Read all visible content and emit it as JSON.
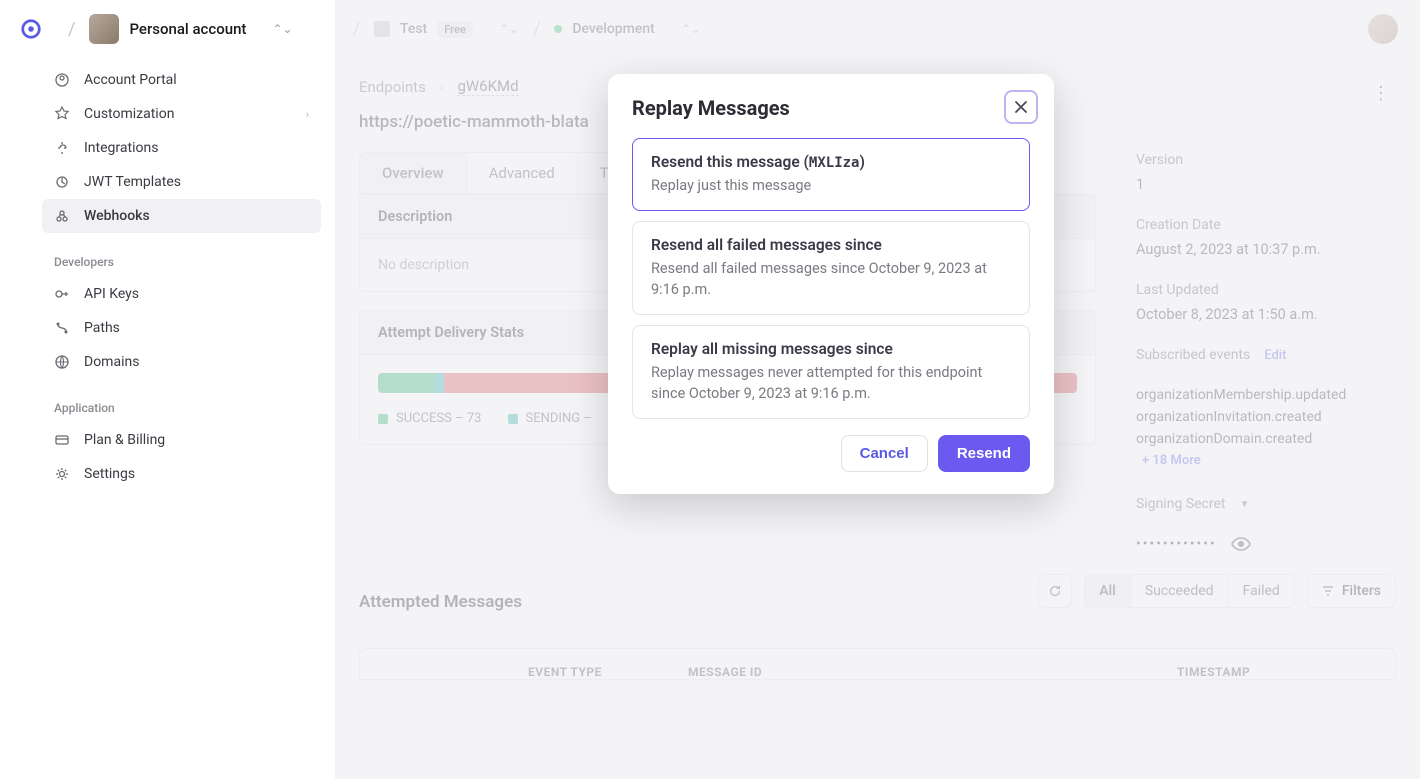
{
  "topbar": {
    "account_name": "Personal account",
    "env1_name": "Test",
    "env1_badge": "Free",
    "env2_name": "Development"
  },
  "sidebar": {
    "items": [
      {
        "label": "Account Portal"
      },
      {
        "label": "Customization"
      },
      {
        "label": "Integrations"
      },
      {
        "label": "JWT Templates"
      },
      {
        "label": "Webhooks"
      }
    ],
    "section_dev": "Developers",
    "dev_items": [
      {
        "label": "API Keys"
      },
      {
        "label": "Paths"
      },
      {
        "label": "Domains"
      }
    ],
    "section_app": "Application",
    "app_items": [
      {
        "label": "Plan & Billing"
      },
      {
        "label": "Settings"
      }
    ]
  },
  "breadcrumb": {
    "root": "Endpoints",
    "current": "gW6KMd"
  },
  "endpoint_url_prefix": "https://poetic-mammoth-blata",
  "tabs": {
    "overview": "Overview",
    "advanced": "Advanced",
    "third": "T"
  },
  "description_card": {
    "title": "Description",
    "body": "No description"
  },
  "stats_card": {
    "title": "Attempt Delivery Stats",
    "legend": [
      {
        "label": "SUCCESS – 73",
        "color": "#1fab67"
      },
      {
        "label": "SENDING –",
        "color": "#1fa9a0"
      }
    ]
  },
  "meta": {
    "version_label": "Version",
    "version_value": "1",
    "creation_label": "Creation Date",
    "creation_value": "August 2, 2023 at 10:37 p.m.",
    "updated_label": "Last Updated",
    "updated_value": "October 8, 2023 at 1:50 a.m.",
    "events_label": "Subscribed events",
    "edit": "Edit",
    "events": [
      "organizationMembership.updated",
      "organizationInvitation.created",
      "organizationDomain.created"
    ],
    "more": "+ 18 More",
    "secret_label": "Signing Secret",
    "secret_mask": "••••••••••••"
  },
  "messages": {
    "title": "Attempted Messages",
    "seg_all": "All",
    "seg_succeeded": "Succeeded",
    "seg_failed": "Failed",
    "filters": "Filters",
    "th_event": "EVENT TYPE",
    "th_msg": "MESSAGE ID",
    "th_ts": "TIMESTAMP"
  },
  "modal": {
    "title": "Replay Messages",
    "opt1_title_pre": "Resend this message (",
    "opt1_code": "MXLIza",
    "opt1_title_post": ")",
    "opt1_desc": "Replay just this message",
    "opt2_title": "Resend all failed messages since",
    "opt2_desc": "Resend all failed messages since October 9, 2023 at 9:16 p.m.",
    "opt3_title": "Replay all missing messages since",
    "opt3_desc": "Replay messages never attempted for this endpoint since October 9, 2023 at 9:16 p.m.",
    "cancel": "Cancel",
    "resend": "Resend"
  }
}
